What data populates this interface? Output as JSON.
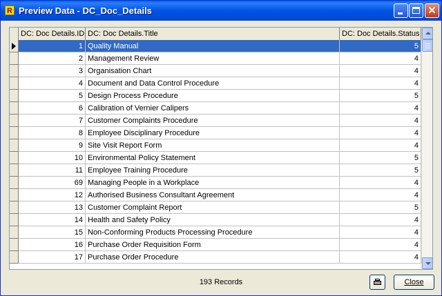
{
  "window": {
    "title": "Preview Data - DC_Doc_Details",
    "app_icon_letter": "R"
  },
  "grid": {
    "columns": [
      "DC: Doc Details.ID",
      "DC: Doc Details.Title",
      "DC: Doc Details.Status"
    ],
    "selected_row_index": 0,
    "rows": [
      {
        "id": "1",
        "title": "Quality Manual",
        "status": "5"
      },
      {
        "id": "2",
        "title": "Management Review",
        "status": "4"
      },
      {
        "id": "3",
        "title": "Organisation Chart",
        "status": "4"
      },
      {
        "id": "4",
        "title": "Document and Data Control Procedure",
        "status": "4"
      },
      {
        "id": "5",
        "title": "Design Process Procedure",
        "status": "5"
      },
      {
        "id": "6",
        "title": "Calibration of Vernier Calipers",
        "status": "4"
      },
      {
        "id": "7",
        "title": "Customer Complaints Procedure",
        "status": "4"
      },
      {
        "id": "8",
        "title": "Employee Disciplinary Procedure",
        "status": "4"
      },
      {
        "id": "9",
        "title": "Site Visit Report Form",
        "status": "4"
      },
      {
        "id": "10",
        "title": "Environmental Policy Statement",
        "status": "5"
      },
      {
        "id": "11",
        "title": "Employee Training Procedure",
        "status": "5"
      },
      {
        "id": "69",
        "title": "Managing People in a Workplace",
        "status": "4"
      },
      {
        "id": "12",
        "title": "Authorised Business Consultant Agreement",
        "status": "4"
      },
      {
        "id": "13",
        "title": "Customer Complaint Report",
        "status": "5"
      },
      {
        "id": "14",
        "title": "Health and Safety Policy",
        "status": "4"
      },
      {
        "id": "15",
        "title": "Non-Conforming Products Processing Procedure",
        "status": "4"
      },
      {
        "id": "16",
        "title": "Purchase Order Requisition Form",
        "status": "4"
      },
      {
        "id": "17",
        "title": "Purchase Order Procedure",
        "status": "4"
      }
    ]
  },
  "footer": {
    "record_count": "193 Records",
    "close_label": "Close",
    "print_icon": "printer-icon"
  },
  "colors": {
    "selection": "#316ac5",
    "titlebar": "#0054e3",
    "window_bg": "#ece9d8"
  }
}
